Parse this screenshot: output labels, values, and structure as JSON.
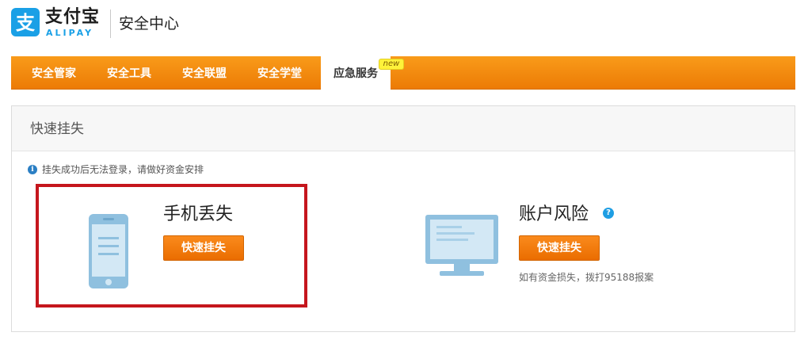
{
  "brand": {
    "name_cn": "支付宝",
    "name_en": "ALIPAY",
    "section_title": "安全中心",
    "logo_icon": "alipay-zhi-logo",
    "brand_color": "#1aa0e6"
  },
  "nav": {
    "accent_color": "#f28a0f",
    "items": [
      {
        "label": "安全管家",
        "active": false
      },
      {
        "label": "安全工具",
        "active": false
      },
      {
        "label": "安全联盟",
        "active": false
      },
      {
        "label": "安全学堂",
        "active": false
      },
      {
        "label": "应急服务",
        "active": true
      }
    ],
    "new_badge": "new"
  },
  "panel": {
    "title": "快速挂失",
    "notice": "挂失成功后无法登录，请做好资金安排",
    "notice_icon": "info-icon"
  },
  "cards": {
    "phone_lost": {
      "title": "手机丢失",
      "button": "快速挂失",
      "icon": "phone-illustration",
      "highlight_color": "#c5161d"
    },
    "account_risk": {
      "title": "账户风险",
      "button": "快速挂失",
      "help_icon": "question-icon",
      "hint": "如有资金损失，拨打95188报案",
      "icon": "monitor-illustration"
    }
  }
}
